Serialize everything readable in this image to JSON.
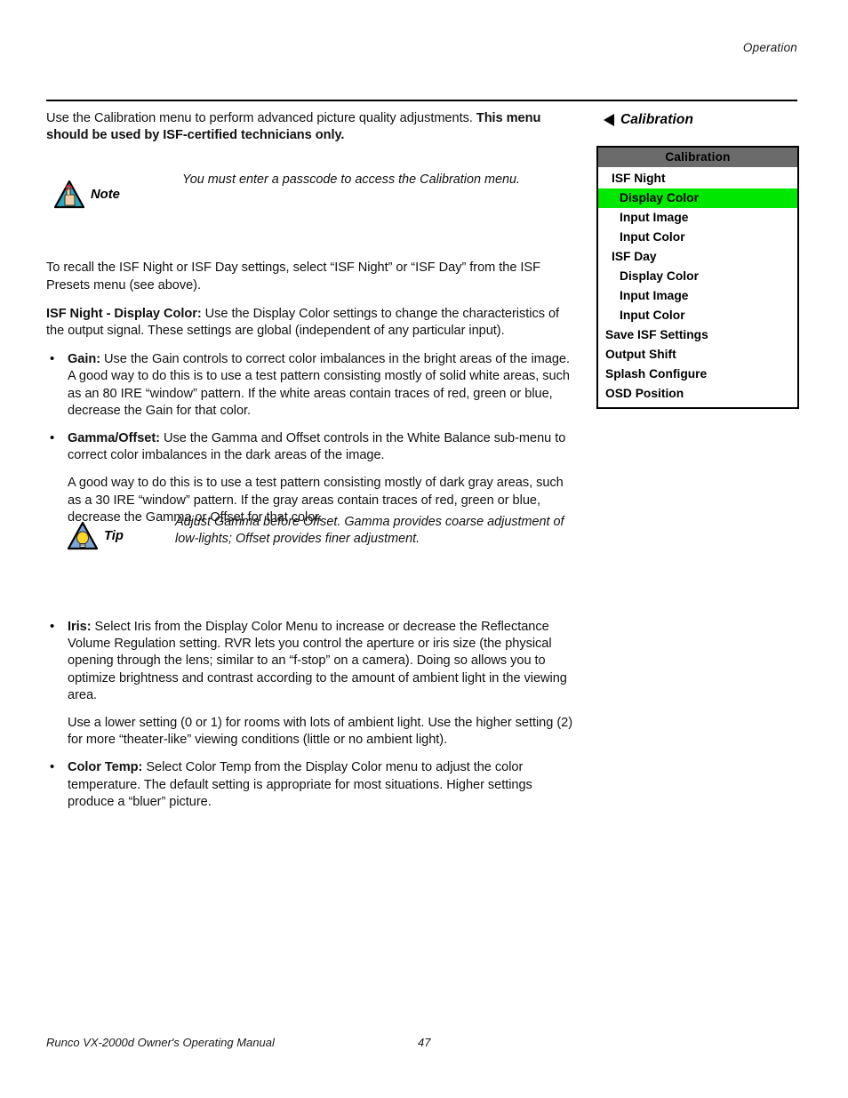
{
  "header": {
    "running_head": "Operation"
  },
  "footer": {
    "manual_title": "Runco VX-2000d Owner's Operating Manual",
    "page_number": "47"
  },
  "content": {
    "intro_plain": "Use the Calibration menu to perform advanced picture quality adjustments. ",
    "intro_bold": "This menu should be used by ISF-certified technicians only.",
    "note": {
      "label": "Note",
      "icon": "note-hand-triangle-icon",
      "text": "You must enter a passcode to access the Calibration menu."
    },
    "recall_para": "To recall the ISF Night or ISF Day settings, select “ISF Night” or “ISF Day” from the ISF Presets menu (see above).",
    "display_color_lead_bold": "ISF Night - Display Color:",
    "display_color_lead_rest": " Use the Display Color settings to change the characteristics of the output signal. These settings are global (independent of any particular input).",
    "bullets": [
      {
        "term": "Gain:",
        "text": " Use the Gain controls to correct color imbalances in the bright areas of the image. A good way to do this is to use a test pattern consisting mostly of solid white areas, such as an 80 IRE “window” pattern. If the white areas contain traces of red, green or blue, decrease the Gain for that color."
      },
      {
        "term": "Gamma/Offset:",
        "text": " Use the Gamma and Offset controls in the White Balance sub-menu to correct color imbalances in the dark areas of the image."
      }
    ],
    "gamma_sub_para": "A good way to do this is to use a test pattern consisting mostly of dark gray areas, such as a 30 IRE “window” pattern. If the gray areas contain traces of red, green or blue, decrease the Gamma or Offset for that color.",
    "tip": {
      "label": "Tip",
      "icon": "tip-lightbulb-triangle-icon",
      "text": "Adjust Gamma before Offset. Gamma provides coarse adjustment of low-lights; Offset provides finer adjustment."
    },
    "iris_bullet": {
      "term": "Iris:",
      "text": " Select Iris from the Display Color Menu to increase or decrease the Reflectance Volume Regulation setting. RVR lets you control the aperture or iris size (the physical opening through the lens; similar to an “f-stop” on a camera). Doing so allows you to optimize brightness and contrast according to the amount of ambient light in the viewing area."
    },
    "iris_sub_para": "Use a lower setting (0 or 1) for rooms with lots of ambient light. Use the higher setting (2) for more “theater-like” viewing conditions (little or no ambient light).",
    "color_temp_bullet": {
      "term": "Color Temp:",
      "text": " Select Color Temp from the Display Color menu to adjust the color temperature. The default setting is appropriate for most situations. Higher settings produce a “bluer” picture."
    }
  },
  "osd": {
    "heading": "Calibration",
    "back_arrow_icon": "left-triangle-icon",
    "menu_title": "Calibration",
    "title_bar_color": "#6b6b6b",
    "highlight_color": "#00e800",
    "items": [
      {
        "label": "ISF Night",
        "level": 1,
        "selected": false
      },
      {
        "label": "Display Color",
        "level": 2,
        "selected": true
      },
      {
        "label": "Input Image",
        "level": 2,
        "selected": false
      },
      {
        "label": "Input Color",
        "level": 2,
        "selected": false
      },
      {
        "label": "ISF Day",
        "level": 1,
        "selected": false
      },
      {
        "label": "Display Color",
        "level": 2,
        "selected": false
      },
      {
        "label": "Input Image",
        "level": 2,
        "selected": false
      },
      {
        "label": "Input Color",
        "level": 2,
        "selected": false
      },
      {
        "label": "Save ISF Settings",
        "level": 0,
        "selected": false
      },
      {
        "label": "Output Shift",
        "level": 0,
        "selected": false
      },
      {
        "label": "Splash Configure",
        "level": 0,
        "selected": false
      },
      {
        "label": "OSD Position",
        "level": 0,
        "selected": false
      }
    ]
  }
}
